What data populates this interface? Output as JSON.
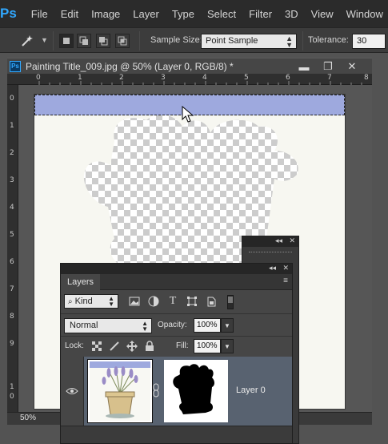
{
  "menubar": {
    "logo": "Ps",
    "items": [
      "File",
      "Edit",
      "Image",
      "Layer",
      "Type",
      "Select",
      "Filter",
      "3D",
      "View",
      "Window"
    ]
  },
  "options": {
    "tool_icon": "magic-wand-icon",
    "sample_size_label": "Sample Size:",
    "sample_size_value": "Point Sample",
    "tolerance_label": "Tolerance:",
    "tolerance_value": "30"
  },
  "document": {
    "ps_badge": "Ps",
    "title": "Painting Title_009.jpg @ 50% (Layer 0, RGB/8) *",
    "minimize": "▬",
    "maximize": "❐",
    "close": "✕",
    "ruler_h": [
      "0",
      "1",
      "2",
      "3",
      "4",
      "5",
      "6",
      "7",
      "8"
    ],
    "ruler_v": [
      "0",
      "1",
      "2",
      "3",
      "4",
      "5",
      "6",
      "7",
      "8",
      "9",
      "1",
      "0"
    ],
    "zoom": "50%"
  },
  "layers_panel": {
    "collapse": "◂◂",
    "close": "✕",
    "tab": "Layers",
    "menu": "≡",
    "kind": "Kind",
    "filter_icons": [
      "image-filter-icon",
      "adjustment-filter-icon",
      "type-filter-icon",
      "shape-filter-icon",
      "smart-object-filter-icon"
    ],
    "blend_mode": "Normal",
    "opacity_label": "Opacity:",
    "opacity_value": "100%",
    "lock_label": "Lock:",
    "fill_label": "Fill:",
    "fill_value": "100%",
    "layer": {
      "name": "Layer 0"
    }
  },
  "colors": {
    "selection_fill": "#9ea9de",
    "layer_highlight": "#586270",
    "ps_blue": "#31a8ff"
  }
}
